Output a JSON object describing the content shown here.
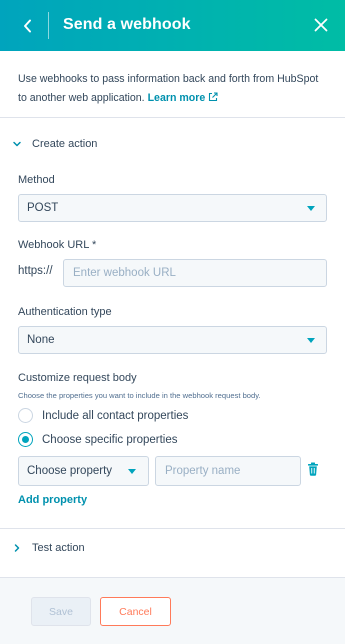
{
  "header": {
    "title": "Send a webhook",
    "back_icon": "chevron-left-icon",
    "close_icon": "close-icon",
    "gradient_start": "#00a4bd",
    "gradient_end": "#00bda5"
  },
  "intro": {
    "text": "Use webhooks to pass information back and forth from HubSpot to another web application.",
    "link_label": "Learn more",
    "link_icon": "external-link-icon"
  },
  "create_action": {
    "label": "Create action",
    "expanded": true
  },
  "method": {
    "label": "Method",
    "value": "POST"
  },
  "webhook_url": {
    "label": "Webhook URL *",
    "prefix": "https://",
    "placeholder": "Enter webhook URL",
    "value": ""
  },
  "authentication": {
    "label": "Authentication type",
    "value": "None"
  },
  "request_body": {
    "label": "Customize request body",
    "help": "Choose the properties you want to include in the webhook request body.",
    "options": [
      {
        "label": "Include all contact properties",
        "checked": false
      },
      {
        "label": "Choose specific properties",
        "checked": true
      }
    ],
    "property_select": "Choose property",
    "property_name_placeholder": "Property name",
    "delete_icon": "trash-icon",
    "add_property_label": "Add property"
  },
  "test_action": {
    "label": "Test action",
    "expanded": false
  },
  "footer": {
    "save_label": "Save",
    "cancel_label": "Cancel"
  },
  "colors": {
    "accent": "#00a4bd",
    "link": "#0091ae",
    "cancel": "#ff7a59",
    "text": "#33475b"
  }
}
